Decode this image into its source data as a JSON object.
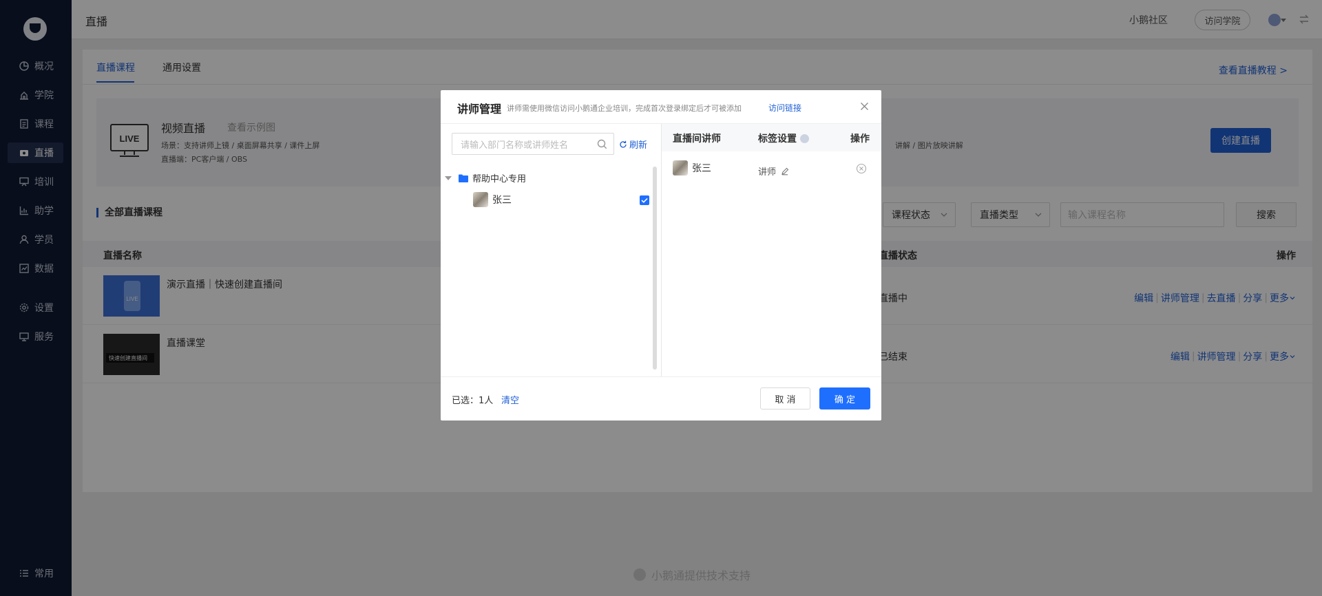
{
  "sidebar": {
    "items": [
      {
        "label": "概况",
        "icon": "pie-chart-icon"
      },
      {
        "label": "学院",
        "icon": "academy-icon"
      },
      {
        "label": "课程",
        "icon": "document-icon"
      },
      {
        "label": "直播",
        "icon": "live-icon"
      },
      {
        "label": "培训",
        "icon": "training-icon"
      },
      {
        "label": "助学",
        "icon": "chart-icon"
      },
      {
        "label": "学员",
        "icon": "user-icon"
      },
      {
        "label": "数据",
        "icon": "data-icon"
      },
      {
        "label": "设置",
        "icon": "gear-icon"
      },
      {
        "label": "服务",
        "icon": "service-icon"
      }
    ],
    "common": "常用",
    "active": "直播"
  },
  "topbar": {
    "title": "直播",
    "community": "小鹅社区",
    "visit_academy": "访问学院"
  },
  "main": {
    "tabs": [
      {
        "label": "直播课程",
        "active": true
      },
      {
        "label": "通用设置",
        "active": false
      }
    ],
    "tutorial_link": "查看直播教程 >",
    "card": {
      "title": "视频直播",
      "example": "查看示例图",
      "scene": "场景：支持讲师上镜 / 桌面屏幕共享 / 课件上屏",
      "push": "直播端：PC客户端 / OBS",
      "right_text": "讲解 / 图片放映讲解",
      "create_button": "创建直播"
    },
    "section_title": "全部直播课程",
    "filters": {
      "status": "课程状态",
      "type": "直播类型",
      "search_placeholder": "输入课程名称",
      "search_button": "搜索"
    },
    "table": {
      "headers": {
        "name": "直播名称",
        "status": "直播状态",
        "actions": "操作"
      },
      "rows": [
        {
          "name": "演示直播｜快速创建直播间",
          "status": "直播中",
          "actions": [
            "编辑",
            "讲师管理",
            "去直播",
            "分享",
            "更多"
          ],
          "thumb_text": "LIVE"
        },
        {
          "name": "直播课堂",
          "status": "已结束",
          "actions": [
            "编辑",
            "讲师管理",
            "分享",
            "更多"
          ],
          "thumb_text": "快速创建直播间"
        }
      ]
    },
    "footer": "小鹅通提供技术支持"
  },
  "modal": {
    "title": "讲师管理",
    "hint": "讲师需使用微信访问小鹅通企业培训，完成首次登录绑定后才可被添加",
    "link": "访问链接",
    "search_placeholder": "请输入部门名称或讲师姓名",
    "refresh": "刷新",
    "department": "帮助中心专用",
    "user": "张三",
    "right_headers": {
      "lecturer": "直播间讲师",
      "tag": "标签设置",
      "action": "操作"
    },
    "assigned": {
      "name": "张三",
      "tag": "讲师"
    },
    "selected_label": "已选：1人",
    "clear": "清空",
    "cancel": "取 消",
    "confirm": "确 定"
  },
  "colors": {
    "accent": "#1f5fd6",
    "primary_button": "#1f6fff",
    "sidebar_bg": "#0f1a33"
  }
}
